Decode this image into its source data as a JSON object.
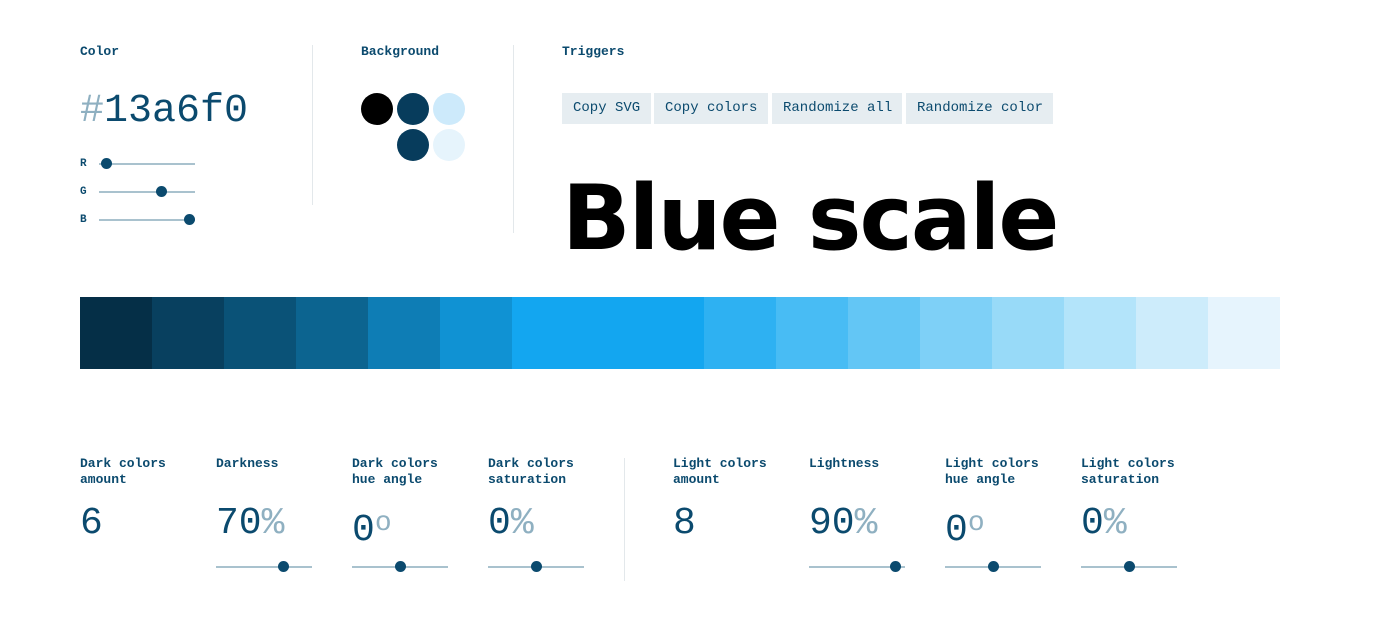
{
  "color": {
    "label": "Color",
    "hash": "#",
    "hex_value": "13a6f0",
    "r_label": "R",
    "r_value": 19,
    "g_label": "G",
    "g_value": 166,
    "b_label": "B",
    "b_value": 240
  },
  "background": {
    "label": "Background",
    "swatches": [
      "#000000",
      "#073c5c",
      "#cdeafb",
      "#073c5c",
      "#e6f4fc"
    ]
  },
  "triggers": {
    "label": "Triggers",
    "buttons": [
      "Copy SVG",
      "Copy colors",
      "Randomize all",
      "Randomize color"
    ]
  },
  "title": "Blue scale",
  "scale_colors": [
    {
      "color": "#052f47",
      "span": 1
    },
    {
      "color": "#08405f",
      "span": 1
    },
    {
      "color": "#0a5277",
      "span": 1
    },
    {
      "color": "#0c6490",
      "span": 1
    },
    {
      "color": "#0e7db5",
      "span": 1
    },
    {
      "color": "#1092d3",
      "span": 1
    },
    {
      "color": "#13a6f0",
      "span": 2.667
    },
    {
      "color": "#2eb1f2",
      "span": 1
    },
    {
      "color": "#48bcf4",
      "span": 1
    },
    {
      "color": "#63c6f5",
      "span": 1
    },
    {
      "color": "#7ed0f7",
      "span": 1
    },
    {
      "color": "#98daf8",
      "span": 1
    },
    {
      "color": "#b3e4fa",
      "span": 1
    },
    {
      "color": "#cdecfb",
      "span": 1
    },
    {
      "color": "#e6f4fd",
      "span": 1
    }
  ],
  "params": {
    "dark_amount": {
      "label": "Dark colors\namount",
      "value": "6"
    },
    "darkness": {
      "label": "Darkness",
      "value": "70",
      "unit": "%",
      "level": 0.7
    },
    "dark_hue": {
      "label": "Dark colors\nhue angle",
      "value": "0",
      "unit": "o",
      "level": 0.5
    },
    "dark_sat": {
      "label": "Dark colors\nsaturation",
      "value": "0",
      "unit": "%",
      "level": 0.5
    },
    "light_amount": {
      "label": "Light colors\namount",
      "value": "8"
    },
    "lightness": {
      "label": "Lightness",
      "value": "90",
      "unit": "%",
      "level": 0.9
    },
    "light_hue": {
      "label": "Light colors\nhue angle",
      "value": "0",
      "unit": "o",
      "level": 0.5
    },
    "light_sat": {
      "label": "Light colors\nsaturation",
      "value": "0",
      "unit": "%",
      "level": 0.5
    }
  },
  "colors": {
    "primary_text": "#0b4a6e",
    "muted_text": "#8fb0c1",
    "button_bg": "#e6edf1",
    "track": "#a9c2ce"
  }
}
